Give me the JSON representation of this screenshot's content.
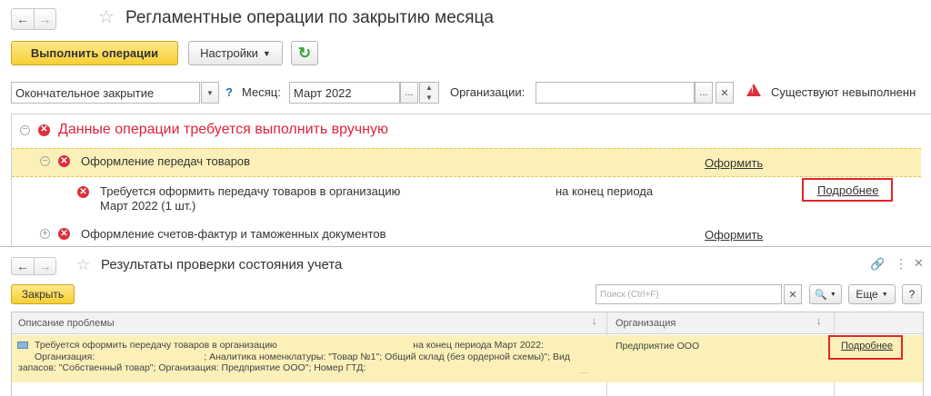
{
  "top": {
    "title": "Регламентные операции по закрытию месяца",
    "run_button": "Выполнить операции",
    "settings_button": "Настройки",
    "mode_value": "Окончательное закрытие",
    "help": "?",
    "month_label": "Месяц:",
    "month_value": "Март 2022",
    "org_label": "Организации:",
    "org_value": "",
    "warning_text": "Существуют невыполненн",
    "group_title": "Данные операции требуется выполнить вручную",
    "op1_title": "Оформление передач товаров",
    "op1_action": "Оформить",
    "op1_detail_line1": "Требуется оформить передачу товаров в организацию",
    "op1_detail_line2": "Март 2022 (1 шт.)",
    "op1_detail_period": "на конец периода",
    "op1_more": "Подробнее",
    "op2_title": "Оформление счетов-фактур и таможенных документов",
    "op2_action": "Оформить"
  },
  "bottom": {
    "title": "Результаты проверки состояния учета",
    "close_button": "Закрыть",
    "search_placeholder": "Поиск (Ctrl+F)",
    "more_button": "Еще",
    "help": "?",
    "columns": [
      "Описание проблемы",
      "Организация"
    ],
    "row": {
      "line1": "Требуется оформить передачу товаров в организацию",
      "line1_tail": "на конец периода Март 2022:",
      "line2": "Организация:",
      "line2_tail": "; Аналитика номенклатуры: \"Товар №1\"; Общий склад (без ордерной схемы)\"; Вид",
      "line3": "запасов: \"Собственный товар\"; Организация: Предприятие ООО\"; Номер ГТД:",
      "ellipsis": "...",
      "org": "Предприятие ООО",
      "more": "Подробнее"
    }
  },
  "colors": {
    "accent_yellow": "#f6cf33",
    "highlight_row": "#fbf0b8",
    "error_red": "#d9303e",
    "annotation_red": "#e2252b",
    "group_title_red": "#e0233a"
  }
}
